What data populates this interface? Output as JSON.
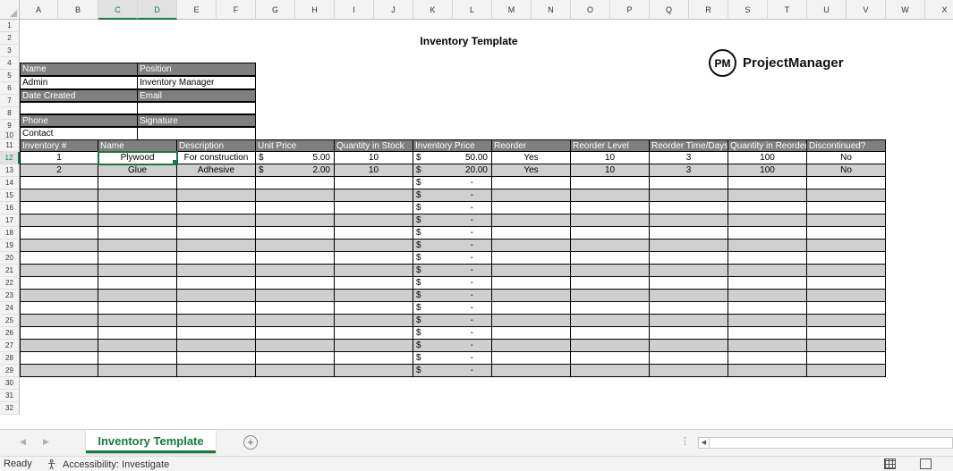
{
  "sheet": {
    "columns": [
      "A",
      "B",
      "C",
      "D",
      "E",
      "F",
      "G",
      "H",
      "I",
      "J",
      "K",
      "L",
      "M",
      "N",
      "O",
      "P",
      "Q",
      "R",
      "S",
      "T",
      "U",
      "V",
      "W",
      "X"
    ],
    "rows": [
      "1",
      "2",
      "3",
      "4",
      "5",
      "6",
      "7",
      "8",
      "9",
      "10",
      "11",
      "12",
      "13",
      "14",
      "15",
      "16",
      "17",
      "18",
      "19",
      "20",
      "21",
      "22",
      "23",
      "24",
      "25",
      "26",
      "27",
      "28",
      "29",
      "30",
      "31",
      "32"
    ],
    "active_columns": [
      "C",
      "D"
    ],
    "active_row": "12",
    "title": "Inventory Template"
  },
  "logo": {
    "badge": "PM",
    "name": "ProjectManager"
  },
  "info": {
    "name_label": "Name",
    "name_value": "Admin",
    "position_label": "Position",
    "position_value": "Inventory Manager",
    "date_label": "Date Created",
    "date_value": "",
    "email_label": "Email",
    "email_value": "",
    "phone_label": "Phone",
    "phone_value": "Contact",
    "signature_label": "Signature",
    "signature_value": ""
  },
  "table": {
    "headers": [
      "Inventory #",
      "Name",
      "Description",
      "Unit Price",
      "Quantity in Stock",
      "Inventory Price",
      "Reorder",
      "Reorder Level",
      "Reorder Time/Days",
      "Quantity in Reorder",
      "Discontinued?"
    ],
    "currency_symbol": "$",
    "empty_price": "-",
    "rows": [
      {
        "id": "1",
        "name": "Plywood",
        "description": "For construction",
        "unit_price": "5.00",
        "qty": "10",
        "inv_price": "50.00",
        "reorder": "Yes",
        "level": "10",
        "days": "3",
        "reorder_qty": "100",
        "discontinued": "No"
      },
      {
        "id": "2",
        "name": "Glue",
        "description": "Adhesive",
        "unit_price": "2.00",
        "qty": "10",
        "inv_price": "20.00",
        "reorder": "Yes",
        "level": "10",
        "days": "3",
        "reorder_qty": "100",
        "discontinued": "No"
      }
    ],
    "blank_row_count": 16
  },
  "tabs": {
    "active_label": "Inventory Template"
  },
  "status": {
    "ready": "Ready",
    "accessibility": "Accessibility: Investigate"
  },
  "colors": {
    "header_gray": "#7f7f7f",
    "band_gray": "#cfcfcf",
    "excel_green": "#107c41"
  }
}
